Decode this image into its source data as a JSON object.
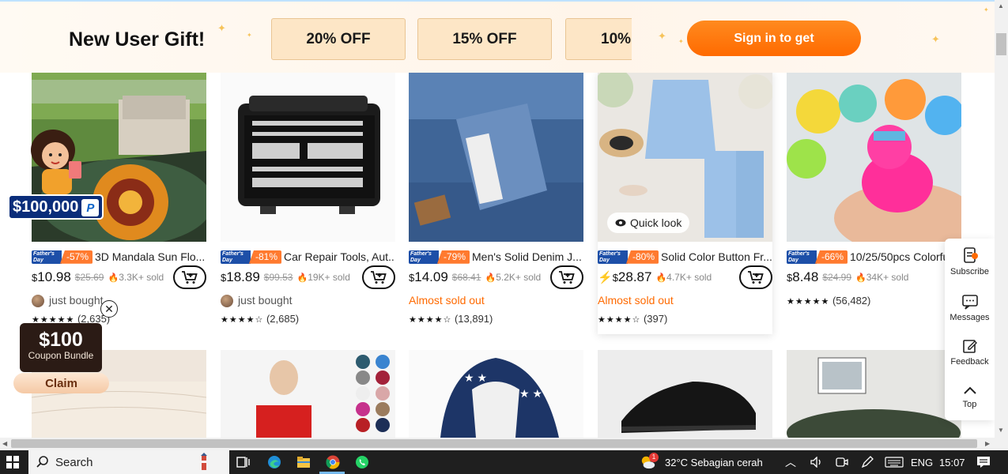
{
  "banner": {
    "title": "New User Gift!",
    "coupons": [
      "20% OFF",
      "15% OFF",
      "10%"
    ],
    "signin_label": "Sign in to get"
  },
  "products_row1": [
    {
      "tag": "Father's Day",
      "discount": "-57%",
      "title": "3D Mandala Sun Flo...",
      "price_symbol": "$",
      "price": "10.98",
      "old_price": "$25.69",
      "sold": "3.3K+ sold",
      "sub": "just bought",
      "rating_count": "(2,635)"
    },
    {
      "tag": "Father's Day",
      "discount": "-81%",
      "title": "Car Repair Tools, Aut...",
      "price_symbol": "$",
      "price": "18.89",
      "old_price": "$99.53",
      "sold": "19K+ sold",
      "sub": "just bought",
      "rating_count": "(2,685)"
    },
    {
      "tag": "Father's Day",
      "discount": "-79%",
      "title": "Men's Solid Denim J...",
      "price_symbol": "$",
      "price": "14.09",
      "old_price": "$68.41",
      "sold": "5.2K+ sold",
      "sub": "Almost sold out",
      "rating_count": "(13,891)"
    },
    {
      "tag": "Father's Day",
      "discount": "-80%",
      "title": "Solid Color Button Fr...",
      "price_symbol": "$",
      "price": "28.87",
      "old_price": "",
      "sold": "4.7K+ sold",
      "sub": "Almost sold out",
      "rating_count": "(397)",
      "quick_look": "Quick look"
    },
    {
      "tag": "Father's Day",
      "discount": "-66%",
      "title": "10/25/50pcs Colorfu",
      "price_symbol": "$",
      "price": "8.48",
      "old_price": "$24.99",
      "sold": "34K+ sold",
      "sub": "",
      "rating_count": "(56,482)"
    }
  ],
  "gift_widget": {
    "amount": "$100,000",
    "badge": "P"
  },
  "coupon_widget": {
    "value": "$100",
    "label": "Coupon Bundle",
    "claim": "Claim"
  },
  "side_toolbar": {
    "subscribe": "Subscribe",
    "messages": "Messages",
    "feedback": "Feedback",
    "top": "Top"
  },
  "taskbar": {
    "search": "Search",
    "weather": "32°C  Sebagian cerah",
    "weather_badge": "1",
    "language": "ENG",
    "time": "15:07"
  },
  "colors": {
    "accent": "#ff6a00",
    "tag_blue": "#1d4fa8"
  }
}
